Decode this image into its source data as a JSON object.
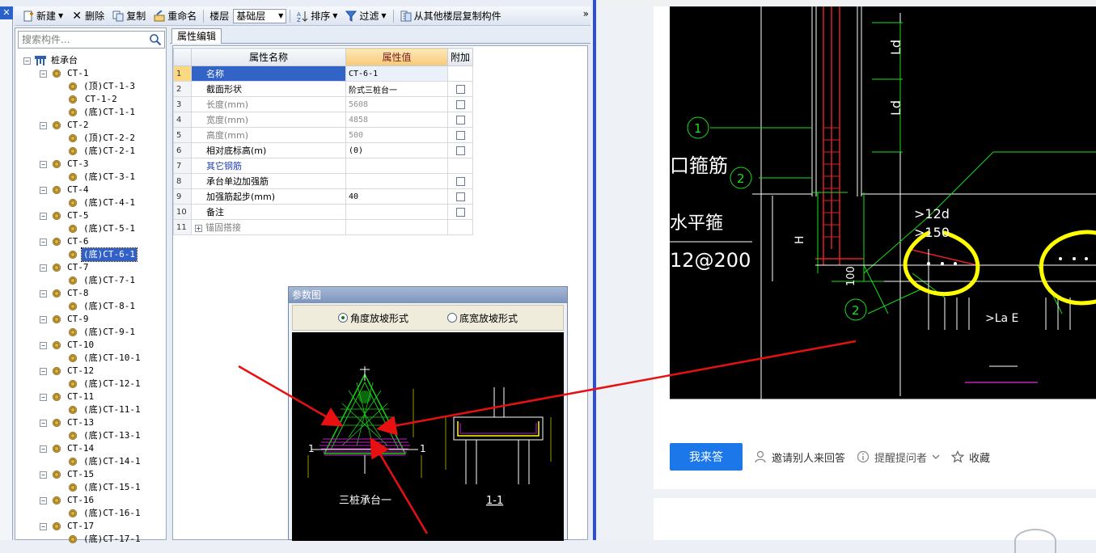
{
  "left_app": {
    "close_label": "✕",
    "toolbar": {
      "new_label": "新建",
      "delete_label": "删除",
      "copy_label": "复制",
      "rename_label": "重命名",
      "floor_label": "楼层",
      "floor_value": "基础层",
      "sort_label": "排序",
      "filter_label": "过滤",
      "copy_from_floor_label": "从其他楼层复制构件",
      "more_label": "»"
    },
    "search": {
      "placeholder": "搜索构件..."
    },
    "tree": {
      "root": "桩承台",
      "groups": [
        {
          "name": "CT-1",
          "children": [
            "(顶)CT-1-3",
            "CT-1-2",
            "(底)CT-1-1"
          ]
        },
        {
          "name": "CT-2",
          "children": [
            "(顶)CT-2-2",
            "(底)CT-2-1"
          ]
        },
        {
          "name": "CT-3",
          "children": [
            "(底)CT-3-1"
          ]
        },
        {
          "name": "CT-4",
          "children": [
            "(底)CT-4-1"
          ]
        },
        {
          "name": "CT-5",
          "children": [
            "(底)CT-5-1"
          ]
        },
        {
          "name": "CT-6",
          "children": [
            "(底)CT-6-1"
          ]
        },
        {
          "name": "CT-7",
          "children": [
            "(底)CT-7-1"
          ]
        },
        {
          "name": "CT-8",
          "children": [
            "(底)CT-8-1"
          ]
        },
        {
          "name": "CT-9",
          "children": [
            "(底)CT-9-1"
          ]
        },
        {
          "name": "CT-10",
          "children": [
            "(底)CT-10-1"
          ]
        },
        {
          "name": "CT-12",
          "children": [
            "(底)CT-12-1"
          ]
        },
        {
          "name": "CT-11",
          "children": [
            "(底)CT-11-1"
          ]
        },
        {
          "name": "CT-13",
          "children": [
            "(底)CT-13-1"
          ]
        },
        {
          "name": "CT-14",
          "children": [
            "(底)CT-14-1"
          ]
        },
        {
          "name": "CT-15",
          "children": [
            "(底)CT-15-1"
          ]
        },
        {
          "name": "CT-16",
          "children": [
            "(底)CT-16-1"
          ]
        },
        {
          "name": "CT-17",
          "children": [
            "(底)CT-17-1"
          ]
        }
      ],
      "selected": "(底)CT-6-1"
    },
    "tab_label": "属性编辑",
    "grid": {
      "headers": {
        "name": "属性名称",
        "value": "属性值",
        "extra": "附加"
      },
      "rows": [
        {
          "num": "1",
          "name": "名称",
          "value": "CT-6-1",
          "check": false
        },
        {
          "num": "2",
          "name": "截面形状",
          "value": "阶式三桩台一",
          "check": true
        },
        {
          "num": "3",
          "name": "长度(mm)",
          "value": "5608",
          "check": true
        },
        {
          "num": "4",
          "name": "宽度(mm)",
          "value": "4858",
          "check": true
        },
        {
          "num": "5",
          "name": "高度(mm)",
          "value": "500",
          "check": true
        },
        {
          "num": "6",
          "name": "相对底标高(m)",
          "value": "(0)",
          "check": true
        },
        {
          "num": "7",
          "name": "其它钢筋",
          "value": "",
          "check": false
        },
        {
          "num": "8",
          "name": "承台单边加强筋",
          "value": "",
          "check": true
        },
        {
          "num": "9",
          "name": "加强筋起步(mm)",
          "value": "40",
          "check": true
        },
        {
          "num": "10",
          "name": "备注",
          "value": "",
          "check": true
        },
        {
          "num": "11",
          "name": "锚固搭接",
          "value": "",
          "check": false
        }
      ]
    },
    "param_dialog": {
      "title": "参数图",
      "option_angle": "角度放坡形式",
      "option_width": "底宽放坡形式",
      "caption_plan": "三桩承台一",
      "caption_section": "1-1",
      "mark_left": "1",
      "mark_right": "1"
    }
  },
  "browser": {
    "cad": {
      "label_ld_top": "Ld",
      "label_ld_mid": "Ld",
      "circle_1": "1",
      "circle_2": "2",
      "circle_2b": "2",
      "text_stirrup": "口箍筋",
      "text_horizontal": "水平箍",
      "text_spacing": "12@200",
      "text_12d": ">12d",
      "text_150": ">150",
      "text_h": "H",
      "text_100": "100",
      "text_la": ">La E"
    },
    "actions": {
      "answer_label": "我来答",
      "invite_label": "邀请别人来回答",
      "remind_label": "提醒提问者",
      "collect_label": "收藏"
    }
  },
  "colors": {
    "selection_blue": "#3160c8",
    "divider_blue": "#2d4fd6",
    "answer_button_blue": "#1c78e8",
    "annotation_red": "#e81010",
    "highlight_yellow": "#ffff00",
    "cad_green": "#18e018"
  }
}
